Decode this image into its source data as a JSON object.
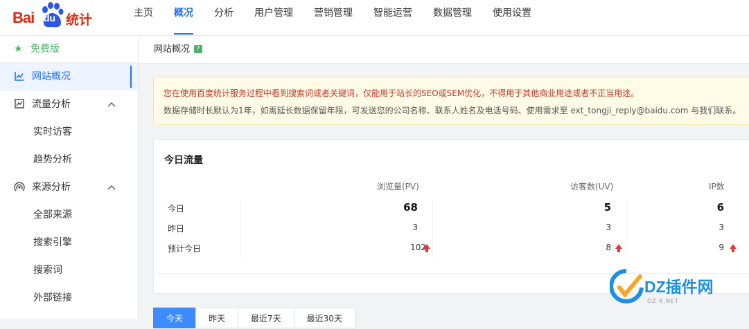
{
  "brand": {
    "bai": "Bai",
    "du": "du",
    "tongji": "统计"
  },
  "nav": [
    {
      "label": "主页"
    },
    {
      "label": "概况"
    },
    {
      "label": "分析"
    },
    {
      "label": "用户管理"
    },
    {
      "label": "营销管理"
    },
    {
      "label": "智能运营"
    },
    {
      "label": "数据管理"
    },
    {
      "label": "使用设置"
    }
  ],
  "sidebar": {
    "free": "免费版",
    "items": [
      {
        "label": "网站概况",
        "icon": "line-chart-icon"
      },
      {
        "label": "流量分析",
        "icon": "trend-icon"
      },
      {
        "label": "实时访客"
      },
      {
        "label": "趋势分析"
      },
      {
        "label": "来源分析",
        "icon": "broadcast-icon"
      },
      {
        "label": "全部来源"
      },
      {
        "label": "搜索引擎"
      },
      {
        "label": "搜索词"
      },
      {
        "label": "外部链接"
      }
    ]
  },
  "breadcrumb": {
    "title": "网站概况",
    "help": "?"
  },
  "notice": {
    "line1": "您在使用百度统计服务过程中看到搜索词或者关键词，仅能用于站长的SEO或SEM优化，不得用于其他商业用途或者不正当用途。",
    "line2": "数据存储时长默认为1年，如需延长数据保留年限，可发送您的公司名称、联系人姓名及电话号码、使用需求至 ext_tongji_reply@baidu.com 与我们联系。"
  },
  "traffic": {
    "title": "今日流量",
    "headers": [
      "浏览量(PV)",
      "访客数(UV)",
      "IP数"
    ],
    "rows": [
      {
        "label": "今日",
        "pv": "68",
        "uv": "5",
        "ip": "6"
      },
      {
        "label": "昨日",
        "pv": "3",
        "uv": "3",
        "ip": "3"
      },
      {
        "label": "预计今日",
        "pv": "102",
        "uv": "8",
        "ip": "9"
      }
    ]
  },
  "tabs": [
    "今天",
    "昨天",
    "最近7天",
    "最近30天"
  ],
  "watermark": {
    "text": "DZ插件网",
    "sub": "DZ-X.NET"
  },
  "colors": {
    "accent": "#1e6fff",
    "brand": "#de2910",
    "free": "#4caf6a",
    "up": "#e03a3a"
  }
}
